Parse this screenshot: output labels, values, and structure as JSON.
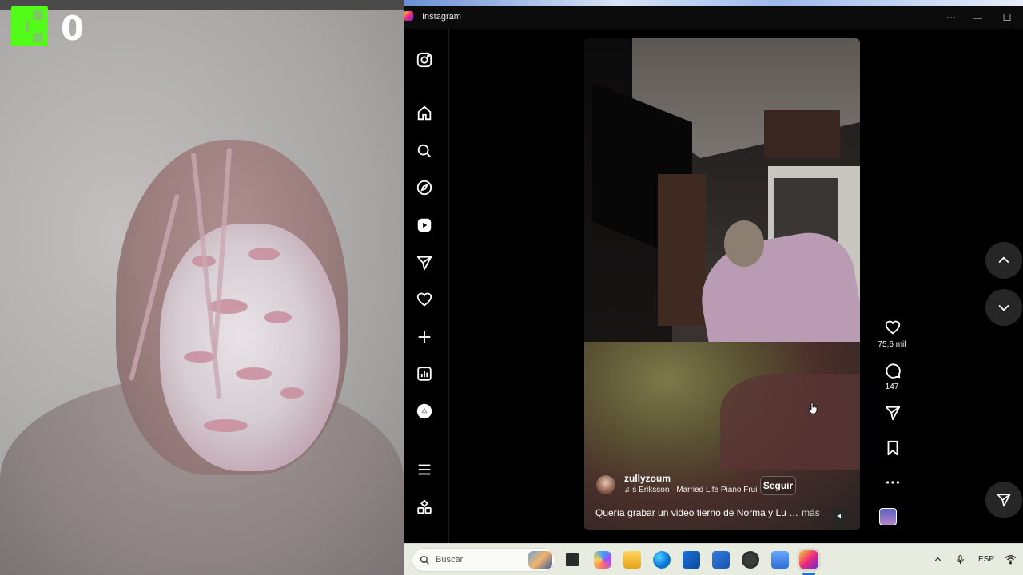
{
  "overlay": {
    "score": "0"
  },
  "window": {
    "title": "Instagram"
  },
  "sidebar": {
    "items": [
      "instagram-logo",
      "home",
      "search",
      "explore",
      "reels",
      "messages",
      "notifications",
      "create",
      "dashboard",
      "threads",
      "more",
      "also-from-meta"
    ]
  },
  "reel": {
    "username": "zullyzoum",
    "music": "s Eriksson · Married Life   Piano Frui",
    "follow_label": "Seguir",
    "caption": "Quería grabar un video tierno de Norma y Lu …",
    "more_label": "más",
    "likes": "75,6 mil",
    "comments": "147"
  },
  "taskbar": {
    "search_placeholder": "Buscar",
    "language": "ESP"
  }
}
